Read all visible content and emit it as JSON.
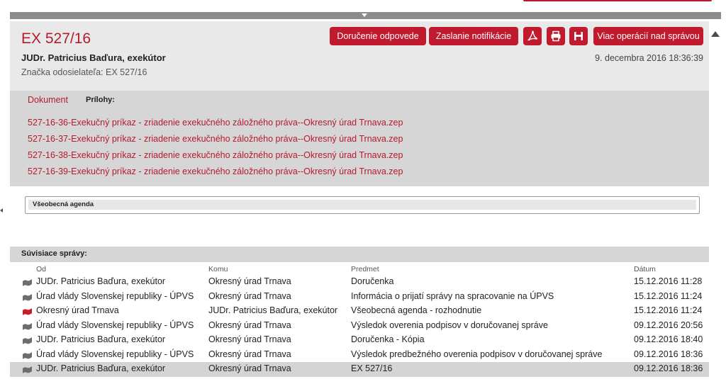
{
  "message": {
    "title": "EX 527/16",
    "sender": "JUDr. Patricius Baďura, exekútor",
    "reference_label": "Značka odosielateľa:",
    "reference_value": "EX 527/16",
    "date": "9. decembra 2016 18:36:39"
  },
  "actions": {
    "delivery_reply": "Doručenie odpovede",
    "send_notification": "Zaslanie notifikácie",
    "pdf_icon": "pdf-icon",
    "print_icon": "print-icon",
    "save_icon": "save-icon",
    "more_operations": "Viac operácií nad správou"
  },
  "attachments": {
    "tab_document": "Dokument",
    "tab_attachments": "Prílohy:",
    "files": [
      "527-16-36-Exekučný príkaz - zriadenie exekučného záložného práva--Okresný úrad Trnava.zep",
      "527-16-37-Exekučný príkaz - zriadenie exekučného záložného práva--Okresný úrad Trnava.zep",
      "527-16-38-Exekučný príkaz - zriadenie exekučného záložného práva--Okresný úrad Trnava.zep",
      "527-16-39-Exekučný príkaz - zriadenie exekučného záložného práva--Okresný úrad Trnava.zep"
    ]
  },
  "agenda": {
    "label": "Všeobecná agenda"
  },
  "related": {
    "title": "Súvisiace správy:",
    "columns": {
      "from": "Od",
      "to": "Komu",
      "subject": "Predmet",
      "date": "Dátum"
    },
    "rows": [
      {
        "from": "JUDr. Patricius Baďura, exekútor",
        "to": "Okresný úrad Trnava",
        "subject": "Doručenka",
        "date": "15.12.2016 11:28",
        "flag": "#6d6d6d",
        "selected": false
      },
      {
        "from": "Úrad vlády Slovenskej republiky - ÚPVS",
        "to": "Okresný úrad Trnava",
        "subject": "Informácia o prijatí správy na spracovanie na ÚPVS",
        "date": "15.12.2016 11:24",
        "flag": "#6d6d6d",
        "selected": false
      },
      {
        "from": "Okresný úrad Trnava",
        "to": "JUDr. Patricius Baďura, exekútor",
        "subject": "Všeobecná agenda - rozhodnutie",
        "date": "15.12.2016 11:24",
        "flag": "#c81b2c",
        "selected": false
      },
      {
        "from": "Úrad vlády Slovenskej republiky - ÚPVS",
        "to": "Okresný úrad Trnava",
        "subject": "Výsledok overenia podpisov v doručovanej správe",
        "date": "09.12.2016 20:56",
        "flag": "#6d6d6d",
        "selected": false
      },
      {
        "from": "JUDr. Patricius Baďura, exekútor",
        "to": "Okresný úrad Trnava",
        "subject": "Doručenka - Kópia",
        "date": "09.12.2016 18:40",
        "flag": "#6d6d6d",
        "selected": false
      },
      {
        "from": "Úrad vlády Slovenskej republiky - ÚPVS",
        "to": "Okresný úrad Trnava",
        "subject": "Výsledok predbežného overenia podpisov v doručovanej správe",
        "date": "09.12.2016 18:36",
        "flag": "#6d6d6d",
        "selected": false
      },
      {
        "from": "JUDr. Patricius Baďura, exekútor",
        "to": "Okresný úrad Trnava",
        "subject": "EX 527/16",
        "date": "09.12.2016 18:36",
        "flag": "#6d6d6d",
        "selected": true
      }
    ]
  },
  "colors": {
    "accent": "#c11a2e",
    "header_bg": "#e9e9e9",
    "panel_bg": "#d6d6d6"
  }
}
